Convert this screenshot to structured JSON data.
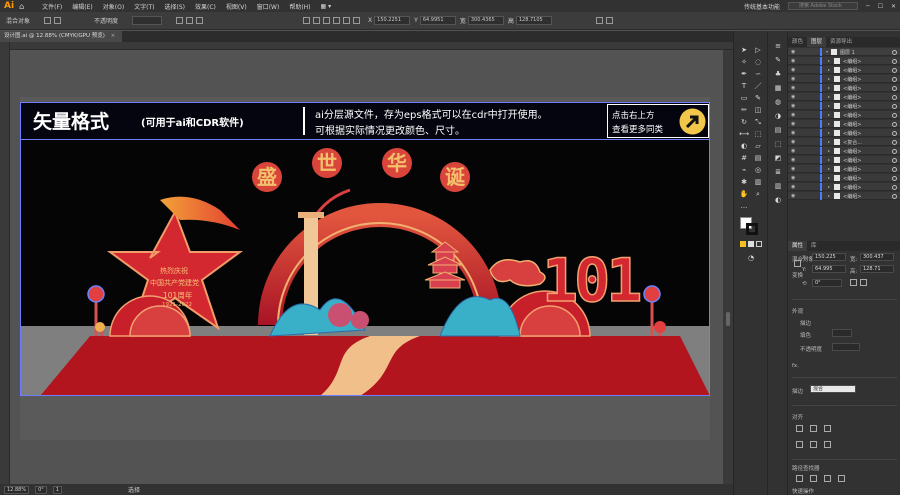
{
  "app": {
    "logo": "Ai",
    "menus": [
      "文件(F)",
      "编辑(E)",
      "对象(O)",
      "文字(T)",
      "选择(S)",
      "效果(C)",
      "视图(V)",
      "窗口(W)",
      "帮助(H)"
    ],
    "workspace": "传统基本功能",
    "search_placeholder": "搜索 Adobe Stock"
  },
  "control_bar": {
    "selection_label": "混合对象",
    "opacity_label": "不透明度",
    "x_label": "X",
    "x_value": "150.2251",
    "y_label": "Y",
    "y_value": "64.9951",
    "w_label": "宽",
    "w_value": "300.4365",
    "h_label": "高",
    "h_value": "128.7105"
  },
  "document_tab": {
    "title": "设计图.ai @ 12.88% (CMYK/GPU 预览)",
    "close": "×"
  },
  "status_bar": {
    "zoom": "12.88%",
    "rotation": "0°",
    "artboard": "1",
    "tool": "选择"
  },
  "artwork": {
    "banner_title": "矢量格式",
    "banner_subtitle": "(可用于ai和CDR软件)",
    "banner_line1": "ai分层源文件，存为eps格式可以在cdr中打开使用。",
    "banner_line2": "可根据实际情况更改颜色、尺寸。",
    "corner_line1": "点击右上方",
    "corner_line2": "查看更多同类",
    "arch_chars": [
      "盛",
      "世",
      "华",
      "诞"
    ],
    "star_line1": "热烈庆祝",
    "star_line2": "中国共产党建党",
    "star_line3": "101周年",
    "star_line4": "1921-2022",
    "big_number": "101"
  },
  "panels": {
    "top_tabs": [
      "颜色",
      "图层",
      "资源导出"
    ],
    "active_top_tab": "图层",
    "layers": [
      {
        "name": "图层 1",
        "type": "layer"
      },
      {
        "name": "<编组>",
        "type": "group"
      },
      {
        "name": "<编组>",
        "type": "group"
      },
      {
        "name": "<编组>",
        "type": "group"
      },
      {
        "name": "<编组>",
        "type": "group"
      },
      {
        "name": "<编组>",
        "type": "group"
      },
      {
        "name": "<编组>",
        "type": "group"
      },
      {
        "name": "<编组>",
        "type": "group"
      },
      {
        "name": "<编组>",
        "type": "group"
      },
      {
        "name": "<编组>",
        "type": "group"
      },
      {
        "name": "<复合...",
        "type": "group"
      },
      {
        "name": "<编组>",
        "type": "group"
      },
      {
        "name": "<编组>",
        "type": "group"
      },
      {
        "name": "<编组>",
        "type": "group"
      },
      {
        "name": "<编组>",
        "type": "group"
      },
      {
        "name": "<编组>",
        "type": "group"
      },
      {
        "name": "<编组>",
        "type": "group"
      }
    ],
    "props_tabs": [
      "属性",
      "库"
    ],
    "props_section": "混合对象",
    "transform_label": "变换",
    "x_label": "X:",
    "x_value": "150.225",
    "y_label": "Y:",
    "y_value": "64.995",
    "w_label": "宽:",
    "w_value": "300.437",
    "h_label": "高:",
    "h_value": "128.71",
    "rotate_value": "0°",
    "appearance_label": "外观",
    "stroke_label": "描边",
    "fill_label": "填色",
    "opacity_label": "不透明度",
    "blend_label": "混合",
    "align_label": "对齐",
    "pathfinder_label": "路径查找器",
    "quick_actions_label": "快速操作"
  },
  "colors": {
    "accent_blue": "#4d7cff",
    "bg_dark": "#323232",
    "red": "#b5182a",
    "gold": "#f2c05b"
  }
}
